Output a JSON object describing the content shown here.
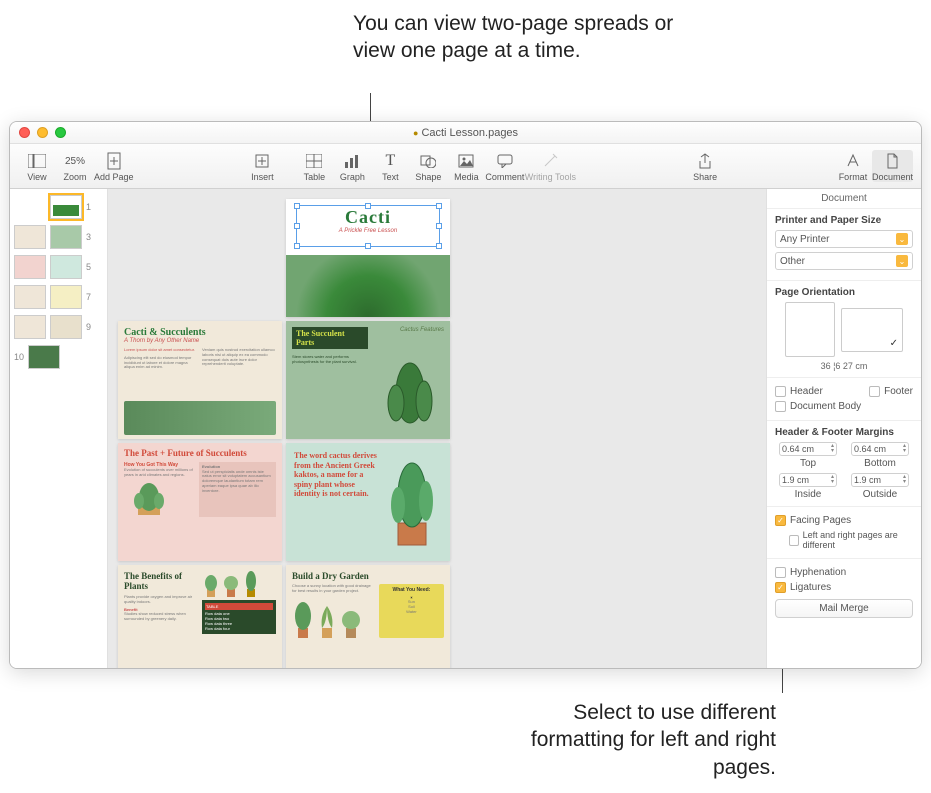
{
  "callouts": {
    "top": "You can view two-page spreads or view one page at a time.",
    "bottom": "Select to use different formatting for left and right pages."
  },
  "window": {
    "title": "Cacti Lesson.pages",
    "modified_indicator": "●"
  },
  "toolbar": {
    "view": "View",
    "zoom": "Zoom",
    "zoom_value": "25%",
    "add_page": "Add Page",
    "insert": "Insert",
    "table": "Table",
    "graph": "Graph",
    "text": "Text",
    "shape": "Shape",
    "media": "Media",
    "comment": "Comment",
    "writing_tools": "Writing Tools",
    "share": "Share",
    "format": "Format",
    "document": "Document"
  },
  "thumbnails": {
    "numbers": [
      "1",
      "3",
      "5",
      "7",
      "9",
      "10"
    ]
  },
  "pages": {
    "p1_title": "Cacti",
    "p1_sub": "A Prickle Free Lesson",
    "p2_title": "Cacti & Succulents",
    "p2_sub": "A Thorn by Any Other Name",
    "p3_title": "The Succulent Parts",
    "p3_label": "Cactus Features",
    "p4_title": "The Past + Future of Succulents",
    "p4_how": "How You Got This Way",
    "p5_quote": "The word cactus derives from the Ancient Greek kaktos, a name for a spiny plant whose identity is not certain.",
    "p6_title": "The Benefits of Plants",
    "p7_title": "Build a Dry Garden",
    "p7_box_title": "What You Need:"
  },
  "inspector": {
    "tab": "Document",
    "section_printer": "Printer and Paper Size",
    "printer_value": "Any Printer",
    "paper_value": "Other",
    "section_orientation": "Page Orientation",
    "dims": "36 ¦6 27 cm",
    "header_label": "Header",
    "footer_label": "Footer",
    "document_body_label": "Document Body",
    "section_margins": "Header & Footer Margins",
    "margin_top_value": "0.64 cm",
    "margin_top_label": "Top",
    "margin_bottom_value": "0.64 cm",
    "margin_bottom_label": "Bottom",
    "margin_inside_value": "1.9 cm",
    "margin_inside_label": "Inside",
    "margin_outside_value": "1.9 cm",
    "margin_outside_label": "Outside",
    "facing_pages": "Facing Pages",
    "lr_different": "Left and right pages are different",
    "hyphenation": "Hyphenation",
    "ligatures": "Ligatures",
    "mail_merge": "Mail Merge"
  }
}
